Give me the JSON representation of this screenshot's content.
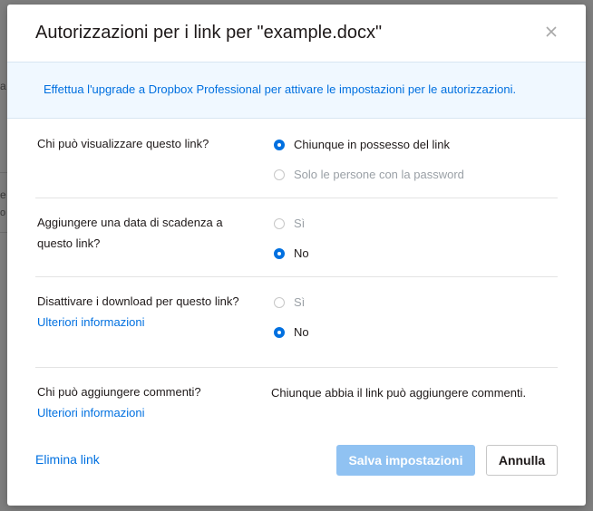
{
  "background": {
    "fragment_1": "a",
    "fragment_2": "e",
    "fragment_3": "o"
  },
  "dialog": {
    "title": "Autorizzazioni per i link per \"example.docx\"",
    "close_icon": "close-icon"
  },
  "upgrade": {
    "text": "Effettua l'upgrade a Dropbox Professional per attivare le impostazioni per le autorizzazioni."
  },
  "settings": {
    "visibility": {
      "label": "Chi può visualizzare questo link?",
      "options": [
        {
          "label": "Chiunque in possesso del link",
          "selected": true,
          "enabled": true
        },
        {
          "label": "Solo le persone con la password",
          "selected": false,
          "enabled": false
        }
      ]
    },
    "expiration": {
      "label": "Aggiungere una data di scadenza a questo link?",
      "options": [
        {
          "label": "Sì",
          "selected": false,
          "enabled": false
        },
        {
          "label": "No",
          "selected": true,
          "enabled": true
        }
      ]
    },
    "downloads": {
      "label": "Disattivare i download per questo link?",
      "learn_more": "Ulteriori informazioni",
      "options": [
        {
          "label": "Sì",
          "selected": false,
          "enabled": false
        },
        {
          "label": "No",
          "selected": true,
          "enabled": true
        }
      ]
    },
    "comments": {
      "label": "Chi può aggiungere commenti?",
      "learn_more": "Ulteriori informazioni",
      "value": "Chiunque abbia il link può aggiungere commenti."
    }
  },
  "footer": {
    "delete_link": "Elimina link",
    "save_label": "Salva impostazioni",
    "cancel_label": "Annulla"
  },
  "colors": {
    "accent": "#0070e0",
    "save_disabled": "#90c2f2",
    "upgrade_bg": "#f0f8ff"
  }
}
